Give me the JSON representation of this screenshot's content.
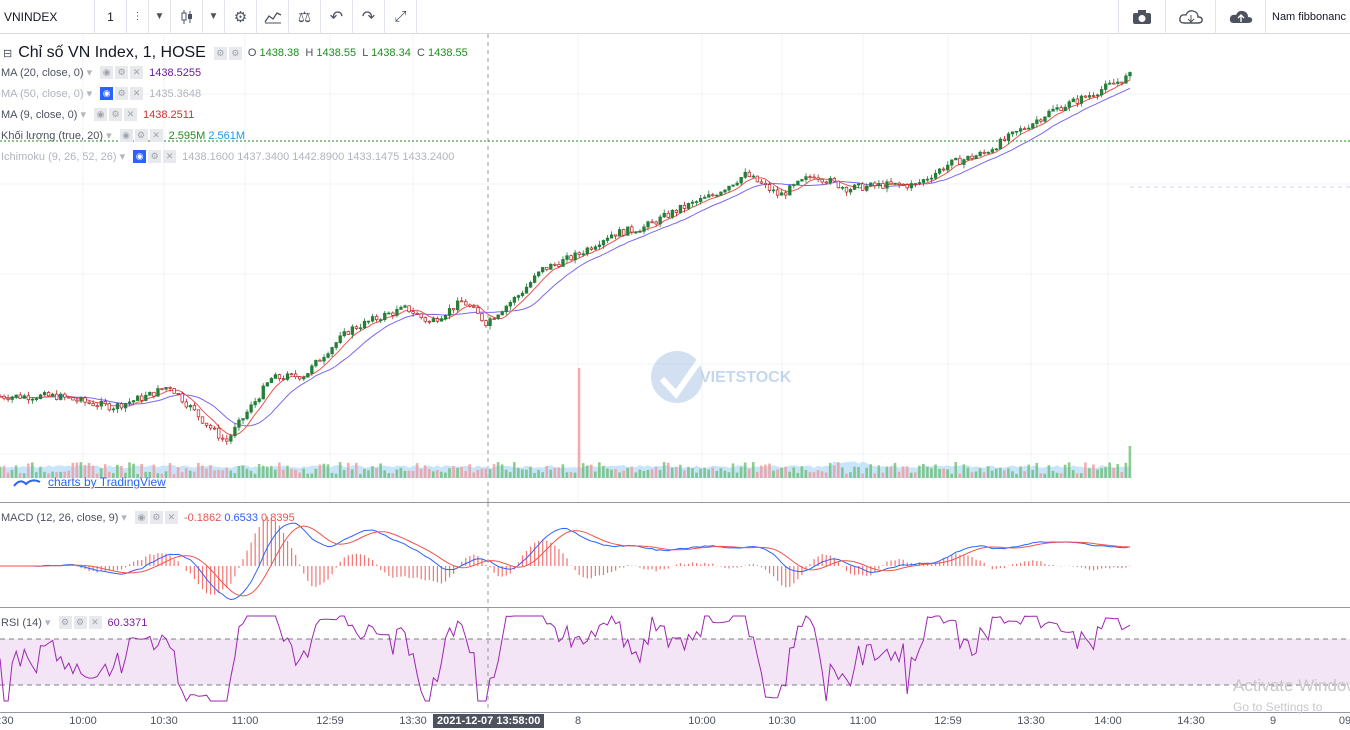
{
  "toolbar": {
    "symbol": "VNINDEX",
    "interval": "1",
    "template": "Nam fibbonanc"
  },
  "main_legend": {
    "title": "Chỉ số VN Index, 1, HOSE",
    "o_label": "O",
    "o_value": "1438.38",
    "h_label": "H",
    "h_value": "1438.55",
    "l_label": "L",
    "l_value": "1438.34",
    "c_label": "C",
    "c_value": "1438.55"
  },
  "indicators": [
    {
      "label": "MA (20, close, 0)",
      "value": "1438.5255",
      "color": "#7b1fa2"
    },
    {
      "label": "MA (50, close, 0)",
      "value": "1435.3648",
      "color": "#b2b5be"
    },
    {
      "label": "MA (9, close, 0)",
      "value": "1438.2511",
      "color": "#d32f2f"
    },
    {
      "label": "Khối lượng (true, 20)",
      "value": "2.595M",
      "value2": "2.561M",
      "color": "#1e8e1e"
    },
    {
      "label": "Ichimoku (9, 26, 52, 26)",
      "values": "1438.1600  1437.3400  1442.8900  1433.1475  1433.2400",
      "color": "#b2b5be"
    }
  ],
  "brand_link": "charts by TradingView",
  "logo_text": "VIETSTOCK",
  "macd": {
    "label": "MACD (12, 26, close, 9)",
    "v1": "-0.1862",
    "v2": "0.6533",
    "v3": "0.8395"
  },
  "rsi": {
    "label": "RSI (14)",
    "value": "60.3371"
  },
  "time_axis": [
    ":30",
    "10:00",
    "10:30",
    "11:00",
    "12:59",
    "13:30",
    "8",
    "10:00",
    "10:30",
    "11:00",
    "12:59",
    "13:30",
    "14:00",
    "14:30",
    "9",
    "09"
  ],
  "crosshair_time": "2021-12-07 13:58:00",
  "os_watermark": {
    "line1": "Activate Windows",
    "line2": "Go to Settings to"
  },
  "colors": {
    "up": "#26a69a",
    "down": "#ef5350",
    "candle_up": "#1b7f3b",
    "candle_down": "#b71c1c",
    "ma20": "#7b68ee",
    "ma9": "#ef5350",
    "rsi": "#9c27b0"
  },
  "series": {
    "price": [
      [
        0,
        1
      ],
      [
        2,
        1
      ],
      [
        5,
        1
      ],
      [
        8,
        -1
      ],
      [
        10,
        -2
      ],
      [
        13,
        1
      ],
      [
        15,
        4
      ],
      [
        18,
        -6
      ],
      [
        20,
        -12
      ],
      [
        22,
        -3
      ],
      [
        24,
        6
      ],
      [
        27,
        7
      ],
      [
        29,
        14
      ],
      [
        31,
        20
      ],
      [
        34,
        24
      ],
      [
        36,
        26
      ],
      [
        38,
        22
      ],
      [
        41,
        28
      ],
      [
        43,
        22
      ],
      [
        46,
        30
      ],
      [
        48,
        37
      ],
      [
        51,
        41
      ],
      [
        54,
        47
      ],
      [
        57,
        49
      ],
      [
        60,
        54
      ],
      [
        63,
        58
      ],
      [
        66,
        64
      ],
      [
        69,
        58
      ],
      [
        72,
        64
      ],
      [
        75,
        60
      ],
      [
        78,
        61
      ],
      [
        81,
        61
      ],
      [
        84,
        67
      ],
      [
        87,
        70
      ],
      [
        90,
        76
      ],
      [
        93,
        82
      ],
      [
        96,
        86
      ],
      [
        100,
        92
      ]
    ],
    "ma_slow": [
      [
        0,
        3
      ],
      [
        5,
        1
      ],
      [
        10,
        -2
      ],
      [
        15,
        1
      ],
      [
        18,
        -4
      ],
      [
        21,
        -8
      ],
      [
        24,
        -4
      ],
      [
        27,
        2
      ],
      [
        30,
        10
      ],
      [
        33,
        18
      ],
      [
        36,
        22
      ],
      [
        39,
        22
      ],
      [
        42,
        23
      ],
      [
        45,
        26
      ],
      [
        48,
        32
      ],
      [
        51,
        37
      ],
      [
        54,
        43
      ],
      [
        57,
        47
      ],
      [
        60,
        50
      ],
      [
        63,
        55
      ],
      [
        66,
        59
      ],
      [
        69,
        60
      ],
      [
        72,
        61
      ],
      [
        75,
        61
      ],
      [
        78,
        62
      ],
      [
        81,
        61
      ],
      [
        84,
        64
      ],
      [
        87,
        68
      ],
      [
        90,
        73
      ],
      [
        93,
        78
      ],
      [
        96,
        83
      ],
      [
        100,
        88
      ]
    ]
  },
  "candles": {
    "main": [
      {
        "x": 0,
        "o": 1426.2,
        "c": 1428.1,
        "h": 1428.5,
        "l": 1425.9
      },
      {
        "x": 1,
        "o": 1428.1,
        "c": 1427.3,
        "h": 1428.4,
        "l": 1427.0
      }
    ]
  }
}
